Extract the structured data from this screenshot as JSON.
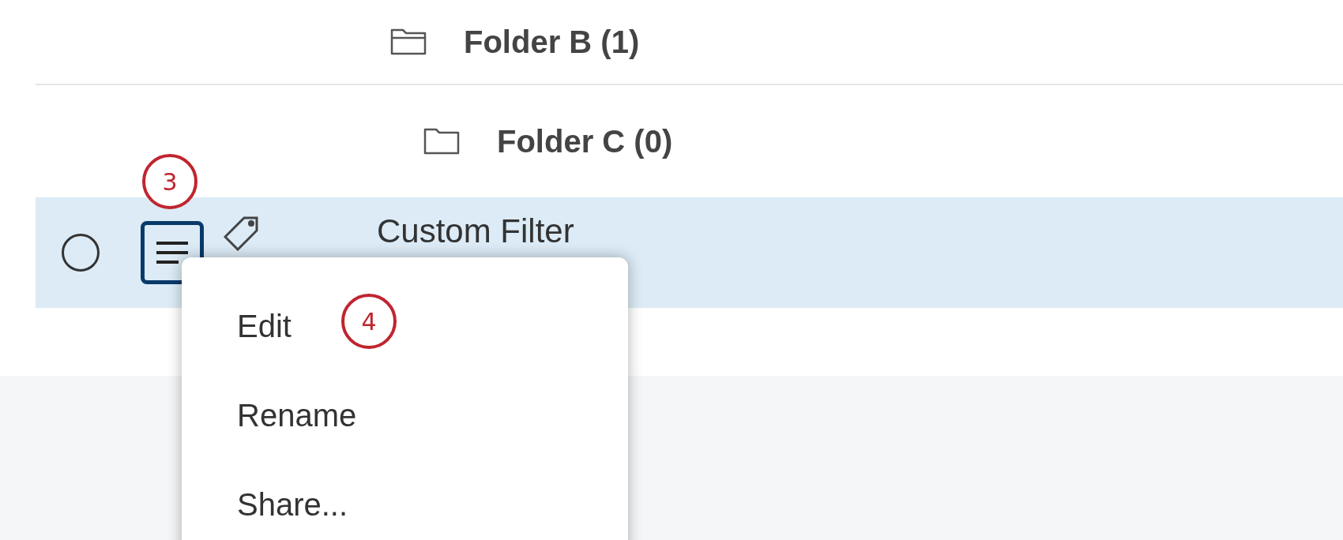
{
  "folders": [
    {
      "label": "Folder B (1)",
      "expanded": true
    },
    {
      "label": "Folder C (0)",
      "expanded": false
    }
  ],
  "filter_row": {
    "name": "Custom Filter",
    "selected": true,
    "checked": false
  },
  "context_menu": {
    "items": [
      "Edit",
      "Rename",
      "Share..."
    ]
  },
  "callouts": [
    {
      "label": "3"
    },
    {
      "label": "4"
    }
  ]
}
